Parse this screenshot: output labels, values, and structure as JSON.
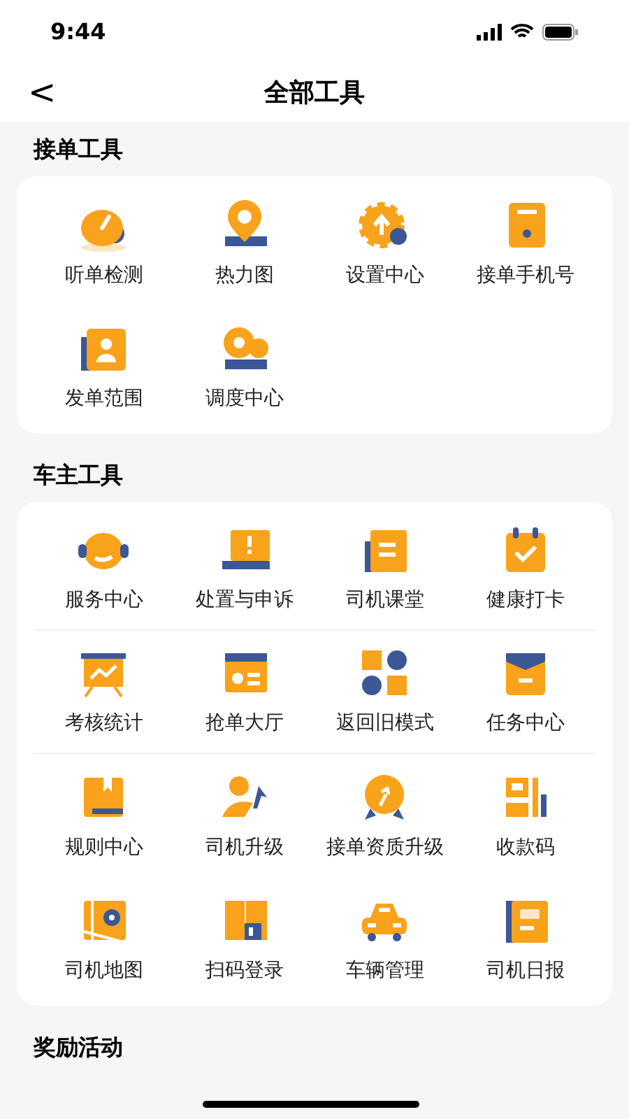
{
  "status_bar": {
    "time": "9:44"
  },
  "header": {
    "back": "<",
    "title": "全部工具"
  },
  "sections": [
    {
      "title": "接单工具",
      "tools": [
        {
          "label": "听单检测"
        },
        {
          "label": "热力图"
        },
        {
          "label": "设置中心"
        },
        {
          "label": "接单手机号"
        },
        {
          "label": "发单范围"
        },
        {
          "label": "调度中心"
        }
      ]
    },
    {
      "title": "车主工具",
      "tools": [
        {
          "label": "服务中心"
        },
        {
          "label": "处置与申诉"
        },
        {
          "label": "司机课堂"
        },
        {
          "label": "健康打卡"
        },
        {
          "label": "考核统计"
        },
        {
          "label": "抢单大厅"
        },
        {
          "label": "返回旧模式"
        },
        {
          "label": "任务中心"
        },
        {
          "label": "规则中心"
        },
        {
          "label": "司机升级"
        },
        {
          "label": "接单资质升级"
        },
        {
          "label": "收款码"
        },
        {
          "label": "司机地图"
        },
        {
          "label": "扫码登录"
        },
        {
          "label": "车辆管理"
        },
        {
          "label": "司机日报"
        }
      ]
    },
    {
      "title": "奖励活动"
    }
  ]
}
